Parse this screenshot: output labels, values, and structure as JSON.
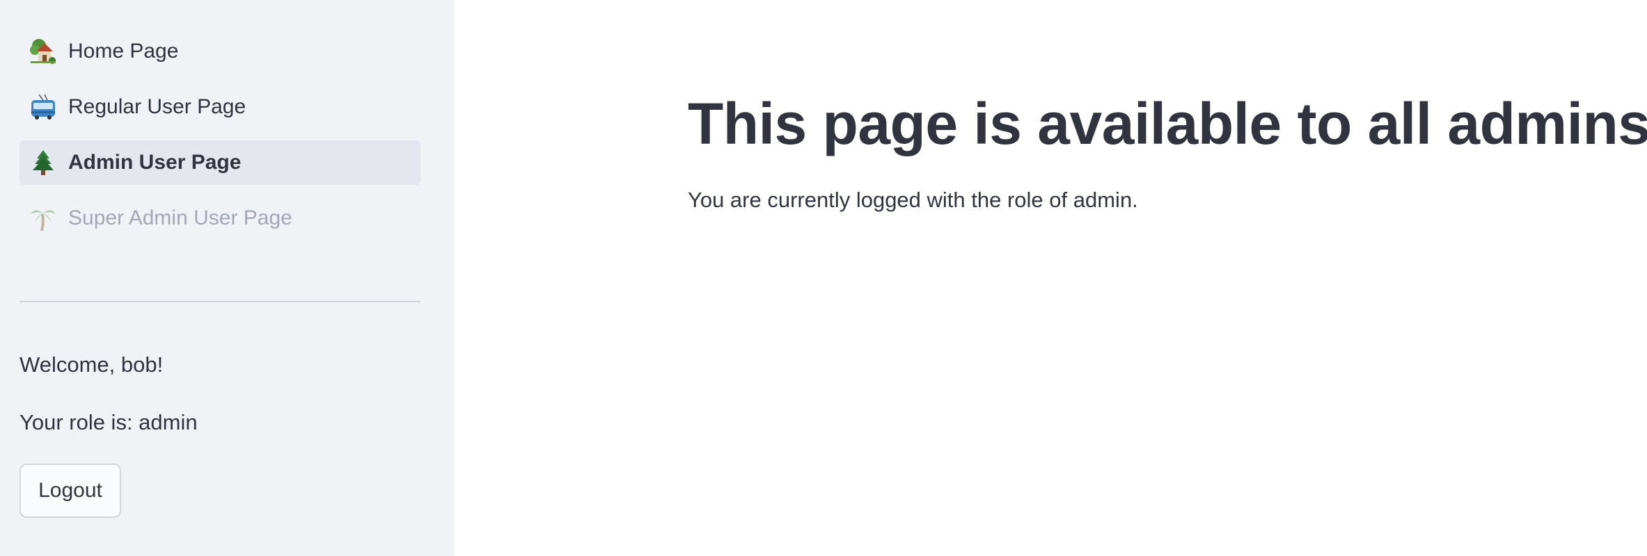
{
  "sidebar": {
    "nav_items": [
      {
        "label": "Home Page",
        "icon": "house-with-garden-icon",
        "state": "normal"
      },
      {
        "label": "Regular User Page",
        "icon": "trolleybus-icon",
        "state": "normal"
      },
      {
        "label": "Admin User Page",
        "icon": "evergreen-tree-icon",
        "state": "active"
      },
      {
        "label": "Super Admin User Page",
        "icon": "palm-tree-icon",
        "state": "disabled"
      }
    ],
    "welcome_text": "Welcome, bob!",
    "role_text": "Your role is: admin",
    "logout_label": "Logout"
  },
  "main": {
    "title": "This page is available to all admins",
    "body_text": "You are currently logged with the role of admin."
  },
  "colors": {
    "sidebar_background": "#f0f2f6",
    "active_item_background": "#e4e7ee",
    "text": "#31333f",
    "disabled_text": "#a3a8b4"
  }
}
